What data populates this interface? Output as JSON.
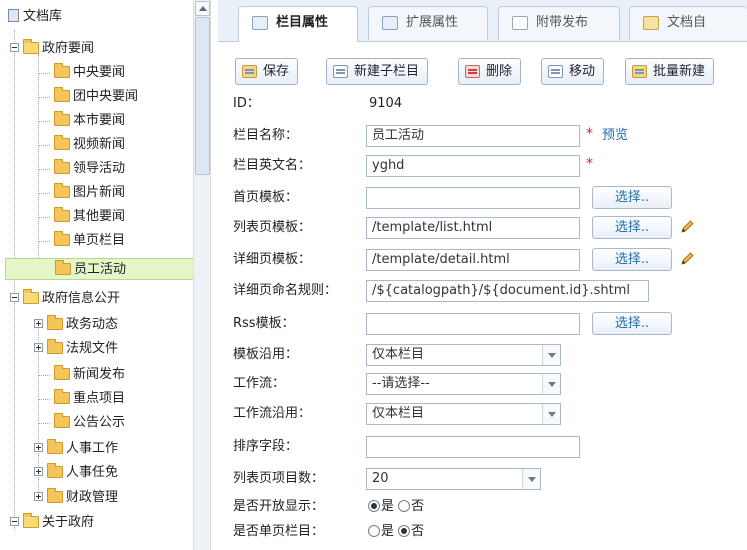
{
  "tree": {
    "root": "文档库",
    "nodes": [
      {
        "label": "政府要闻",
        "expanded": true
      },
      {
        "label": "中央要闻"
      },
      {
        "label": "团中央要闻"
      },
      {
        "label": "本市要闻"
      },
      {
        "label": "视频新闻"
      },
      {
        "label": "领导活动"
      },
      {
        "label": "图片新闻"
      },
      {
        "label": "其他要闻"
      },
      {
        "label": "单页栏目"
      },
      {
        "label": "员工活动",
        "selected": true
      },
      {
        "label": "政府信息公开",
        "expanded": true
      },
      {
        "label": "政务动态"
      },
      {
        "label": "法规文件"
      },
      {
        "label": "新闻发布"
      },
      {
        "label": "重点项目"
      },
      {
        "label": "公告公示"
      },
      {
        "label": "人事工作"
      },
      {
        "label": "人事任免"
      },
      {
        "label": "财政管理"
      },
      {
        "label": "关于政府",
        "expanded": true
      }
    ]
  },
  "tabs": [
    "栏目属性",
    "扩展属性",
    "附带发布",
    "文档自"
  ],
  "toolbar": {
    "save": "保存",
    "new_child": "新建子栏目",
    "delete": "删除",
    "move": "移动",
    "batch_new": "批量新建"
  },
  "form": {
    "id_label": "ID：",
    "id_value": "9104",
    "name_label": "栏目名称：",
    "name_value": "员工活动",
    "preview": "预览",
    "en_label": "栏目英文名：",
    "en_value": "yghd",
    "home_tpl_label": "首页模板：",
    "home_tpl_value": "",
    "list_tpl_label": "列表页模板：",
    "list_tpl_value": "/template/list.html",
    "detail_tpl_label": "详细页模板：",
    "detail_tpl_value": "/template/detail.html",
    "naming_label": "详细页命名规则：",
    "naming_value": "/${catalogpath}/${document.id}.shtml",
    "rss_label": "Rss模板：",
    "rss_value": "",
    "tpl_inherit_label": "模板沿用：",
    "tpl_inherit_value": "仅本栏目",
    "workflow_label": "工作流：",
    "workflow_value": "--请选择--",
    "wf_inherit_label": "工作流沿用：",
    "wf_inherit_value": "仅本栏目",
    "sort_label": "排序字段：",
    "sort_value": "",
    "list_count_label": "列表页项目数：",
    "list_count_value": "20",
    "open_label": "是否开放显示：",
    "open_yes": "是",
    "open_no": "否",
    "single_label": "是否单页栏目：",
    "single_yes": "是",
    "single_no": "否",
    "choose": "选择.."
  },
  "colors": {
    "accent_link": "#1f6fb0",
    "required": "#e02020",
    "selected_bg": "#e5f6c9"
  }
}
